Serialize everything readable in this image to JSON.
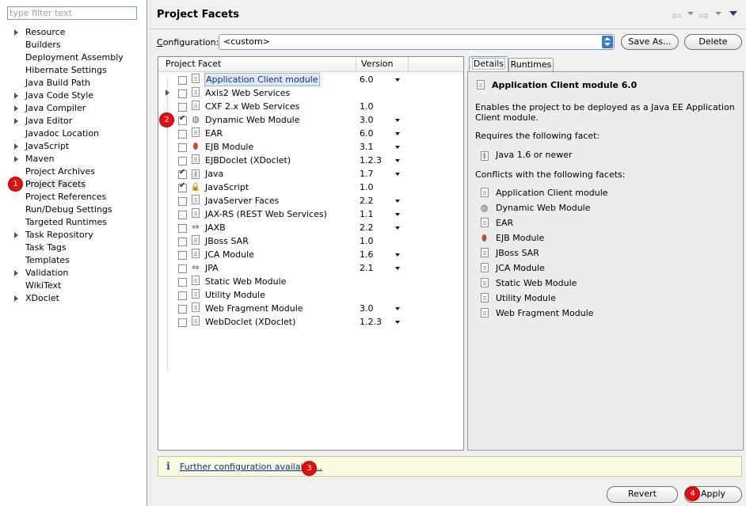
{
  "filter": {
    "placeholder": "type filter text"
  },
  "nav": [
    {
      "label": "Resource",
      "expandable": true
    },
    {
      "label": "Builders",
      "expandable": false
    },
    {
      "label": "Deployment Assembly",
      "expandable": false
    },
    {
      "label": "Hibernate Settings",
      "expandable": false
    },
    {
      "label": "Java Build Path",
      "expandable": false
    },
    {
      "label": "Java Code Style",
      "expandable": true
    },
    {
      "label": "Java Compiler",
      "expandable": true
    },
    {
      "label": "Java Editor",
      "expandable": true
    },
    {
      "label": "Javadoc Location",
      "expandable": false
    },
    {
      "label": "JavaScript",
      "expandable": true
    },
    {
      "label": "Maven",
      "expandable": true
    },
    {
      "label": "Project Archives",
      "expandable": false
    },
    {
      "label": "Project Facets",
      "expandable": false,
      "selected": true
    },
    {
      "label": "Project References",
      "expandable": false
    },
    {
      "label": "Run/Debug Settings",
      "expandable": false
    },
    {
      "label": "Targeted Runtimes",
      "expandable": false
    },
    {
      "label": "Task Repository",
      "expandable": true
    },
    {
      "label": "Task Tags",
      "expandable": false
    },
    {
      "label": "Templates",
      "expandable": false
    },
    {
      "label": "Validation",
      "expandable": true
    },
    {
      "label": "WikiText",
      "expandable": false
    },
    {
      "label": "XDoclet",
      "expandable": true
    }
  ],
  "header": {
    "title": "Project Facets"
  },
  "config": {
    "label": "Configuration:",
    "value": "<custom>",
    "save_as": "Save As...",
    "delete": "Delete"
  },
  "table": {
    "col_facet": "Project Facet",
    "col_version": "Version",
    "rows": [
      {
        "name": "Application Client module",
        "version": "6.0",
        "checked": false,
        "dd": true,
        "icon": "page-icon",
        "selected": true
      },
      {
        "name": "Axis2 Web Services",
        "version": "",
        "checked": false,
        "dd": false,
        "icon": "page-icon",
        "expandable": true
      },
      {
        "name": "CXF 2.x Web Services",
        "version": "1.0",
        "checked": false,
        "dd": false,
        "icon": "page-icon"
      },
      {
        "name": "Dynamic Web Module",
        "version": "3.0",
        "checked": true,
        "dd": true,
        "icon": "globe-icon"
      },
      {
        "name": "EAR",
        "version": "6.0",
        "checked": false,
        "dd": true,
        "icon": "page-icon"
      },
      {
        "name": "EJB Module",
        "version": "3.1",
        "checked": false,
        "dd": true,
        "icon": "bean-icon"
      },
      {
        "name": "EJBDoclet (XDoclet)",
        "version": "1.2.3",
        "checked": false,
        "dd": true,
        "icon": "page-icon"
      },
      {
        "name": "Java",
        "version": "1.7",
        "checked": true,
        "dd": true,
        "icon": "java-icon"
      },
      {
        "name": "JavaScript",
        "version": "1.0",
        "checked": true,
        "dd": false,
        "icon": "js-icon"
      },
      {
        "name": "JavaServer Faces",
        "version": "2.2",
        "checked": false,
        "dd": true,
        "icon": "page-icon"
      },
      {
        "name": "JAX-RS (REST Web Services)",
        "version": "1.1",
        "checked": false,
        "dd": true,
        "icon": "page-icon"
      },
      {
        "name": "JAXB",
        "version": "2.2",
        "checked": false,
        "dd": true,
        "icon": "arrows-icon"
      },
      {
        "name": "JBoss SAR",
        "version": "1.0",
        "checked": false,
        "dd": false,
        "icon": "page-icon"
      },
      {
        "name": "JCA Module",
        "version": "1.6",
        "checked": false,
        "dd": true,
        "icon": "page-icon"
      },
      {
        "name": "JPA",
        "version": "2.1",
        "checked": false,
        "dd": true,
        "icon": "arrows-icon"
      },
      {
        "name": "Static Web Module",
        "version": "",
        "checked": false,
        "dd": false,
        "icon": "page-icon"
      },
      {
        "name": "Utility Module",
        "version": "",
        "checked": false,
        "dd": false,
        "icon": "page-icon"
      },
      {
        "name": "Web Fragment Module",
        "version": "3.0",
        "checked": false,
        "dd": true,
        "icon": "page-icon"
      },
      {
        "name": "WebDoclet (XDoclet)",
        "version": "1.2.3",
        "checked": false,
        "dd": true,
        "icon": "page-icon"
      }
    ]
  },
  "tabs": {
    "details": "Details",
    "runtimes": "Runtimes"
  },
  "details": {
    "title": "Application Client module 6.0",
    "desc_line1": "Enables the project to be deployed as a Java EE Application",
    "desc_line2": "Client module.",
    "requires_label": "Requires the following facet:",
    "requires": [
      {
        "name": "Java 1.6 or newer",
        "icon": "java-icon"
      }
    ],
    "conflicts_label": "Conflicts with the following facets:",
    "conflicts": [
      {
        "name": "Application Client module",
        "icon": "page-icon"
      },
      {
        "name": "Dynamic Web Module",
        "icon": "globe-icon"
      },
      {
        "name": "EAR",
        "icon": "page-icon"
      },
      {
        "name": "EJB Module",
        "icon": "bean-icon"
      },
      {
        "name": "JBoss SAR",
        "icon": "page-icon"
      },
      {
        "name": "JCA Module",
        "icon": "page-icon"
      },
      {
        "name": "Static Web Module",
        "icon": "page-icon"
      },
      {
        "name": "Utility Module",
        "icon": "page-icon"
      },
      {
        "name": "Web Fragment Module",
        "icon": "page-icon"
      }
    ]
  },
  "info": {
    "icon": "i",
    "link": "Further configuration available..."
  },
  "buttons": {
    "revert": "Revert",
    "apply": "Apply"
  },
  "badges": [
    "1",
    "2",
    "3",
    "4"
  ],
  "colors": {
    "badge": "#e01010",
    "link": "#00309f",
    "selection": "#e2e9f5"
  }
}
